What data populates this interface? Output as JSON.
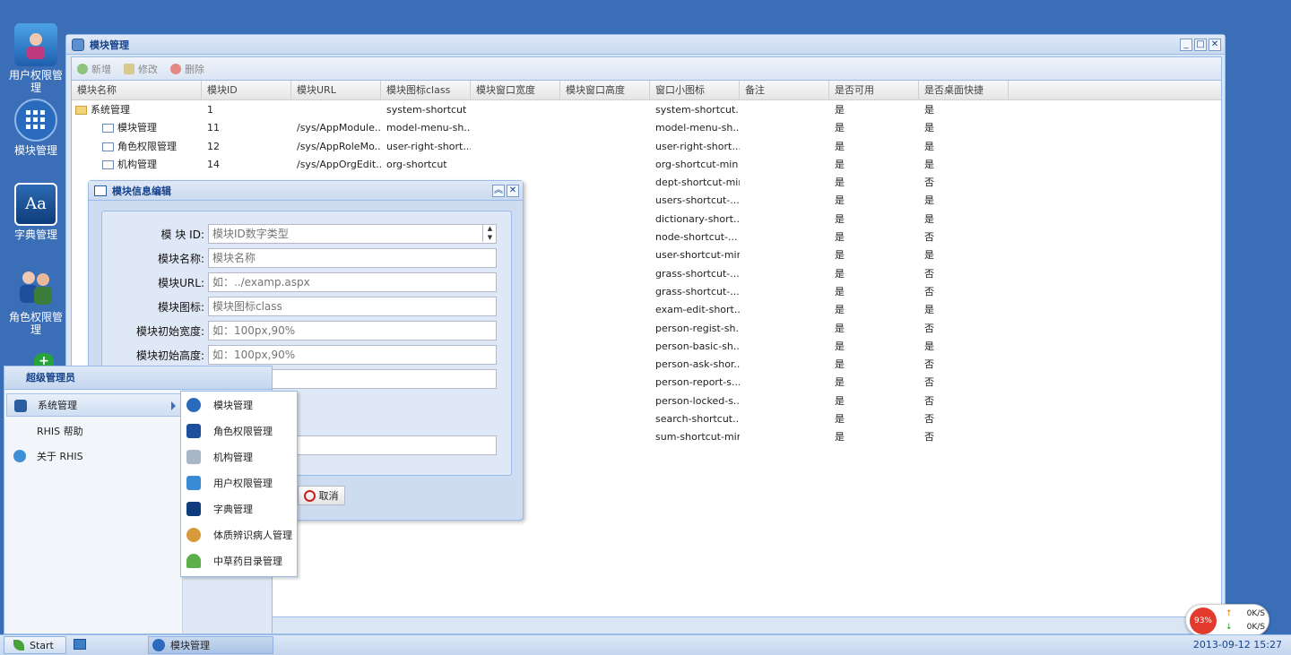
{
  "desktop": {
    "icons": [
      {
        "label": "用户权限管理"
      },
      {
        "label": "模块管理"
      },
      {
        "label": "字典管理"
      },
      {
        "label": "角色权限管理"
      }
    ]
  },
  "window": {
    "title": "模块管理",
    "toolbar": {
      "add": "新增",
      "edit": "修改",
      "delete": "删除"
    },
    "columns": [
      "模块名称",
      "模块ID",
      "模块URL",
      "模块图标class",
      "模块窗口宽度",
      "模块窗口高度",
      "窗口小图标",
      "备注",
      "是否可用",
      "是否桌面快捷"
    ],
    "rows": [
      [
        "系统管理",
        "1",
        "",
        "system-shortcut",
        "",
        "",
        "system-shortcut...",
        "",
        "是",
        "是"
      ],
      [
        "模块管理",
        "11",
        "/sys/AppModule...",
        "model-menu-sh...",
        "",
        "",
        "model-menu-sh...",
        "",
        "是",
        "是"
      ],
      [
        "角色权限管理",
        "12",
        "/sys/AppRoleMo...",
        "user-right-short...",
        "",
        "",
        "user-right-short...",
        "",
        "是",
        "是"
      ],
      [
        "机构管理",
        "14",
        "/sys/AppOrgEdit...",
        "org-shortcut",
        "",
        "",
        "org-shortcut-min",
        "",
        "是",
        "是"
      ],
      [
        "",
        "",
        "",
        "",
        "",
        "",
        "dept-shortcut-min",
        "",
        "是",
        "否"
      ],
      [
        "",
        "",
        "",
        "",
        "",
        "",
        "users-shortcut-...",
        "",
        "是",
        "是"
      ],
      [
        "",
        "",
        "",
        "",
        "",
        "",
        "dictionary-short...",
        "",
        "是",
        "是"
      ],
      [
        "",
        "",
        "",
        "",
        "",
        "",
        "node-shortcut-...",
        "",
        "是",
        "否"
      ],
      [
        "",
        "",
        "",
        "",
        "",
        "",
        "user-shortcut-min",
        "",
        "是",
        "是"
      ],
      [
        "",
        "",
        "",
        "",
        "",
        "",
        "grass-shortcut-...",
        "",
        "是",
        "否"
      ],
      [
        "",
        "",
        "",
        "",
        "",
        "",
        "grass-shortcut-...",
        "",
        "是",
        "否"
      ],
      [
        "",
        "",
        "",
        "",
        "",
        "",
        "exam-edit-short...",
        "",
        "是",
        "是"
      ],
      [
        "",
        "",
        "",
        "",
        "",
        "",
        "person-regist-sh...",
        "",
        "是",
        "否"
      ],
      [
        "",
        "",
        "",
        "",
        "",
        "",
        "person-basic-sh...",
        "",
        "是",
        "是"
      ],
      [
        "",
        "",
        "",
        "",
        "",
        "",
        "person-ask-shor...",
        "",
        "是",
        "否"
      ],
      [
        "",
        "",
        "",
        "",
        "",
        "",
        "person-report-s...",
        "",
        "是",
        "否"
      ],
      [
        "",
        "",
        "",
        "",
        "",
        "",
        "person-locked-s...",
        "",
        "是",
        "否"
      ],
      [
        "",
        "",
        "",
        "",
        "",
        "",
        "search-shortcut...",
        "",
        "是",
        "否"
      ],
      [
        "",
        "",
        "",
        "",
        "",
        "",
        "sum-shortcut-min",
        "",
        "是",
        "否"
      ]
    ]
  },
  "dialog": {
    "title": "模块信息编辑",
    "fields": [
      {
        "label": "模 块 ID:",
        "placeholder": "模块ID数字类型"
      },
      {
        "label": "模块名称:",
        "placeholder": "模块名称"
      },
      {
        "label": "模块URL:",
        "placeholder": "如：../examp.aspx"
      },
      {
        "label": "模块图标:",
        "placeholder": "模块图标class"
      },
      {
        "label": "模块初始宽度:",
        "placeholder": "如：100px,90%"
      },
      {
        "label": "模块初始高度:",
        "placeholder": "如：100px,90%"
      }
    ],
    "cancel": "取消"
  },
  "start_menu": {
    "header": "超级管理员",
    "items": [
      "系统管理",
      "RHIS 帮助",
      "关于 RHIS"
    ],
    "submenu": [
      "模块管理",
      "角色权限管理",
      "机构管理",
      "用户权限管理",
      "字典管理",
      "体质辨识病人管理",
      "中草药目录管理"
    ]
  },
  "taskbar": {
    "start": "Start",
    "task": "模块管理",
    "clock": "2013-09-12 15:27"
  },
  "net_widget": {
    "cpu": "93%",
    "up": "0K/S",
    "down": "0K/S"
  }
}
